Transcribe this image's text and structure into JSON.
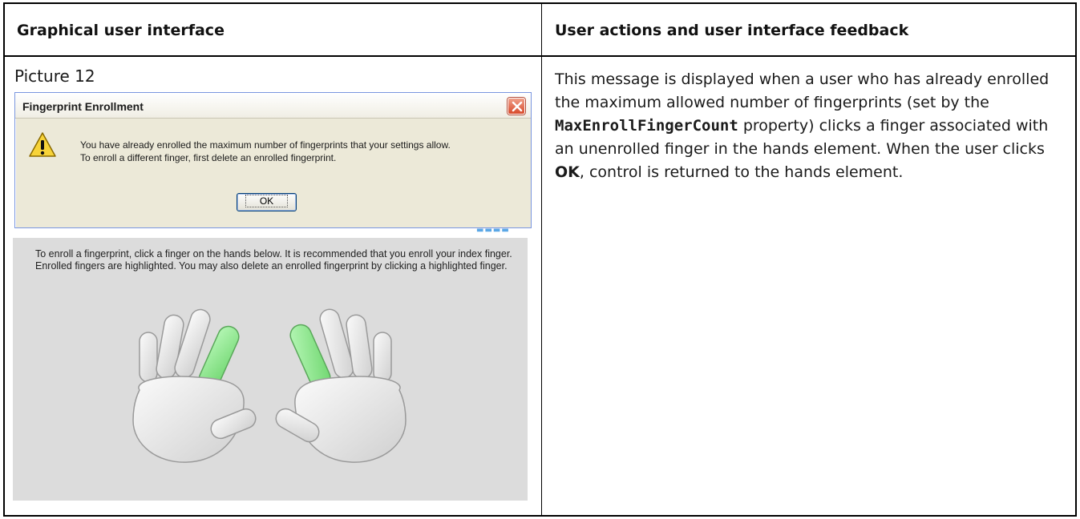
{
  "table": {
    "header_left": "Graphical user interface",
    "header_right": "User actions and user interface feedback"
  },
  "picture": {
    "label": "Picture 12"
  },
  "dialog": {
    "title": "Fingerprint Enrollment",
    "message_line1": "You have already enrolled the maximum number of fingerprints that your settings allow.",
    "message_line2": "To enroll a different finger, first delete an enrolled fingerprint.",
    "ok_label": "OK",
    "icon": "warning-icon"
  },
  "enrollment_panel": {
    "instructions": "To enroll a fingerprint, click a finger on the hands below. It is recommended that you enroll your index finger. Enrolled fingers are highlighted. You may also delete an enrolled fingerprint by clicking a highlighted finger.",
    "highlight_color": "#8ee88e",
    "enrolled_fingers": [
      "left-index",
      "right-index"
    ]
  },
  "description": {
    "part1": "This message is displayed when a user who has already enrolled the maximum allowed number of fingerprints (set by the ",
    "property_name": "MaxEnrollFingerCount",
    "part2": " property) clicks a finger associated with an unenrolled finger in the hands element. When the user clicks ",
    "ok_word": "OK",
    "part3": ", control is returned to the hands element."
  }
}
